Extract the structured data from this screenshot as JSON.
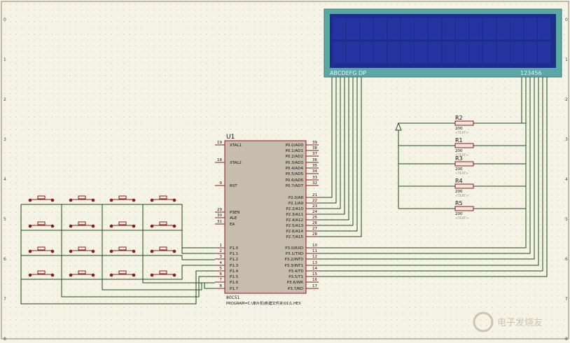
{
  "sheet": {
    "left_marks": [
      "0",
      "1",
      "2",
      "3",
      "4",
      "5",
      "6",
      "7",
      "8"
    ],
    "right_marks": [
      "0",
      "1",
      "2",
      "3",
      "4",
      "5",
      "6",
      "7",
      "8"
    ]
  },
  "mcu": {
    "ref": "U1",
    "part": "80C51",
    "program": "PROGRAM=C:\\单片机\\新建文件夹\\01\\1.HEX",
    "left_pins": [
      {
        "num": "19",
        "name": "XTAL1"
      },
      {
        "num": "18",
        "name": "XTAL2"
      },
      {
        "num": "9",
        "name": "RST"
      },
      {
        "num": "29",
        "name": "PSEN"
      },
      {
        "num": "30",
        "name": "ALE"
      },
      {
        "num": "31",
        "name": "EA"
      },
      {
        "num": "1",
        "name": "P1.0"
      },
      {
        "num": "2",
        "name": "P1.1"
      },
      {
        "num": "3",
        "name": "P1.2"
      },
      {
        "num": "4",
        "name": "P1.3"
      },
      {
        "num": "5",
        "name": "P1.4"
      },
      {
        "num": "6",
        "name": "P1.5"
      },
      {
        "num": "7",
        "name": "P1.6"
      },
      {
        "num": "8",
        "name": "P1.7"
      }
    ],
    "right_pins": [
      {
        "num": "39",
        "name": "P0.0/AD0"
      },
      {
        "num": "38",
        "name": "P0.1/AD1"
      },
      {
        "num": "37",
        "name": "P0.2/AD2"
      },
      {
        "num": "36",
        "name": "P0.3/AD3"
      },
      {
        "num": "35",
        "name": "P0.4/AD4"
      },
      {
        "num": "34",
        "name": "P0.5/AD5"
      },
      {
        "num": "33",
        "name": "P0.6/AD6"
      },
      {
        "num": "32",
        "name": "P0.7/AD7"
      },
      {
        "num": "21",
        "name": "P2.0/A8"
      },
      {
        "num": "22",
        "name": "P2.1/A9"
      },
      {
        "num": "23",
        "name": "P2.2/A10"
      },
      {
        "num": "24",
        "name": "P2.3/A11"
      },
      {
        "num": "25",
        "name": "P2.4/A12"
      },
      {
        "num": "26",
        "name": "P2.5/A13"
      },
      {
        "num": "27",
        "name": "P2.6/A14"
      },
      {
        "num": "28",
        "name": "P2.7/A15"
      },
      {
        "num": "10",
        "name": "P3.0/RXD"
      },
      {
        "num": "11",
        "name": "P3.1/TXD"
      },
      {
        "num": "12",
        "name": "P3.2/INT0"
      },
      {
        "num": "13",
        "name": "P3.3/INT1"
      },
      {
        "num": "14",
        "name": "P3.4/T0"
      },
      {
        "num": "15",
        "name": "P3.5/T1"
      },
      {
        "num": "16",
        "name": "P3.6/WR"
      },
      {
        "num": "17",
        "name": "P3.7/RD"
      }
    ]
  },
  "display": {
    "segment_labels": "ABCDEFG DP",
    "digit_labels": "123456"
  },
  "resistors": [
    {
      "ref": "R2",
      "value": "200",
      "text": "<TEXT>"
    },
    {
      "ref": "R1",
      "value": "200",
      "text": "<TEXT>"
    },
    {
      "ref": "R3",
      "value": "200",
      "text": "<TEXT>"
    },
    {
      "ref": "R4",
      "value": "200",
      "text": "<TEXT>"
    },
    {
      "ref": "R5",
      "value": "200",
      "text": "<TEXT>"
    }
  ],
  "watermark": "电子发烧友",
  "colors": {
    "background": "#f5f3e6",
    "grid_dot": "#b9b59e",
    "wire": "#1f4a1f",
    "component": "#8b1a1a",
    "chip_fill": "#c8bcae",
    "lcd_bezel": "#5aa7a3",
    "lcd_screen": "#1c2d8c",
    "lcd_text": "#e8f2ff"
  }
}
